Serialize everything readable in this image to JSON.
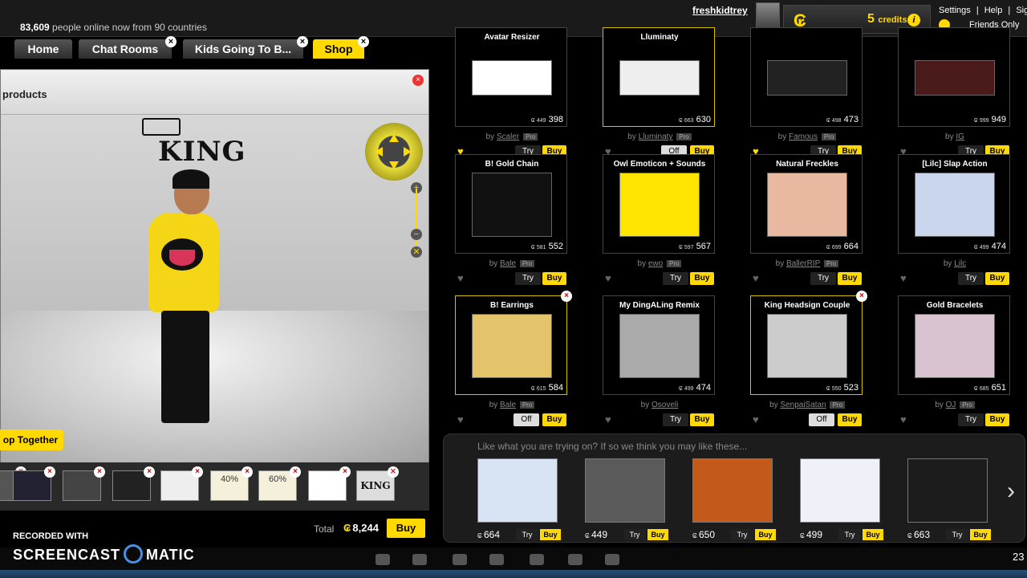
{
  "topbar": {
    "online_count": "83,609",
    "online_suffix": "people online now from 90 countries",
    "username": "freshkidtrey",
    "credits_value": "5",
    "credits_label": "credits",
    "nav": [
      "Settings",
      "|",
      "Help",
      "|",
      "Sign"
    ],
    "friends_label": "Friends Only"
  },
  "tabs": [
    {
      "label": "Home"
    },
    {
      "label": "Chat Rooms"
    },
    {
      "label": "Kids Going To B..."
    },
    {
      "label": "Shop"
    }
  ],
  "left_panel": {
    "title": "products",
    "king_text": "KING",
    "shop_together": "op Together",
    "tray_labels": [
      "40%",
      "60%"
    ],
    "total_label": "Total",
    "total_value": "8,244",
    "buy_label": "Buy"
  },
  "shop": {
    "rows": [
      [
        {
          "title": "Avatar Resizer",
          "price": "398",
          "old": "449",
          "by": "Scaler",
          "pro": "Pro",
          "heart": true,
          "state": "Try"
        },
        {
          "title": "Lluminaty",
          "price": "630",
          "old": "663",
          "by": "Lluminaty",
          "pro": "Pro",
          "heart": false,
          "state": "Off"
        },
        {
          "title": "",
          "price": "473",
          "old": "498",
          "by": "Famous",
          "pro": "Pro",
          "heart": true,
          "state": "Try"
        },
        {
          "title": "",
          "price": "949",
          "old": "999",
          "by": "IG",
          "pro": "",
          "heart": false,
          "state": "Try"
        }
      ],
      [
        {
          "title": "B! Gold Chain",
          "price": "552",
          "old": "581",
          "by": "Bale",
          "pro": "Pro",
          "heart": false,
          "state": "Try"
        },
        {
          "title": "Owl Emoticon + Sounds",
          "price": "567",
          "old": "597",
          "by": "ewo",
          "pro": "Pro",
          "heart": false,
          "state": "Try"
        },
        {
          "title": "Natural Freckles",
          "price": "664",
          "old": "699",
          "by": "BallerRIP",
          "pro": "Pro",
          "heart": false,
          "state": "Try"
        },
        {
          "title": "[Lilc] Slap Action",
          "price": "474",
          "old": "499",
          "by": "Lilc",
          "pro": "",
          "heart": false,
          "state": "Try"
        }
      ],
      [
        {
          "title": "B! Earrings",
          "price": "584",
          "old": "615",
          "by": "Bale",
          "pro": "Pro",
          "heart": false,
          "state": "Off"
        },
        {
          "title": "My DingALing Remix",
          "price": "474",
          "old": "499",
          "by": "Osoveli",
          "pro": "",
          "heart": false,
          "state": "Try"
        },
        {
          "title": "King Headsign Couple",
          "price": "523",
          "old": "550",
          "by": "SenpaiSatan",
          "pro": "Pro",
          "heart": false,
          "state": "Off"
        },
        {
          "title": "Gold Bracelets",
          "price": "651",
          "old": "685",
          "by": "OJ",
          "pro": "Pro",
          "heart": false,
          "state": "Try"
        }
      ]
    ],
    "try_label": "Try",
    "off_label": "Off",
    "buy_label": "Buy",
    "by_prefix": "by"
  },
  "recommend": {
    "title": "Like what you are trying on? If so we think you may like these...",
    "items": [
      {
        "price": "664"
      },
      {
        "price": "449"
      },
      {
        "price": "650"
      },
      {
        "price": "499"
      },
      {
        "price": "663"
      }
    ],
    "try_label": "Try",
    "buy_label": "Buy"
  },
  "watermark": {
    "recorded_with": "RECORDED WITH",
    "brand_left": "SCREENCAST",
    "brand_right": "MATIC"
  },
  "clock": "23"
}
